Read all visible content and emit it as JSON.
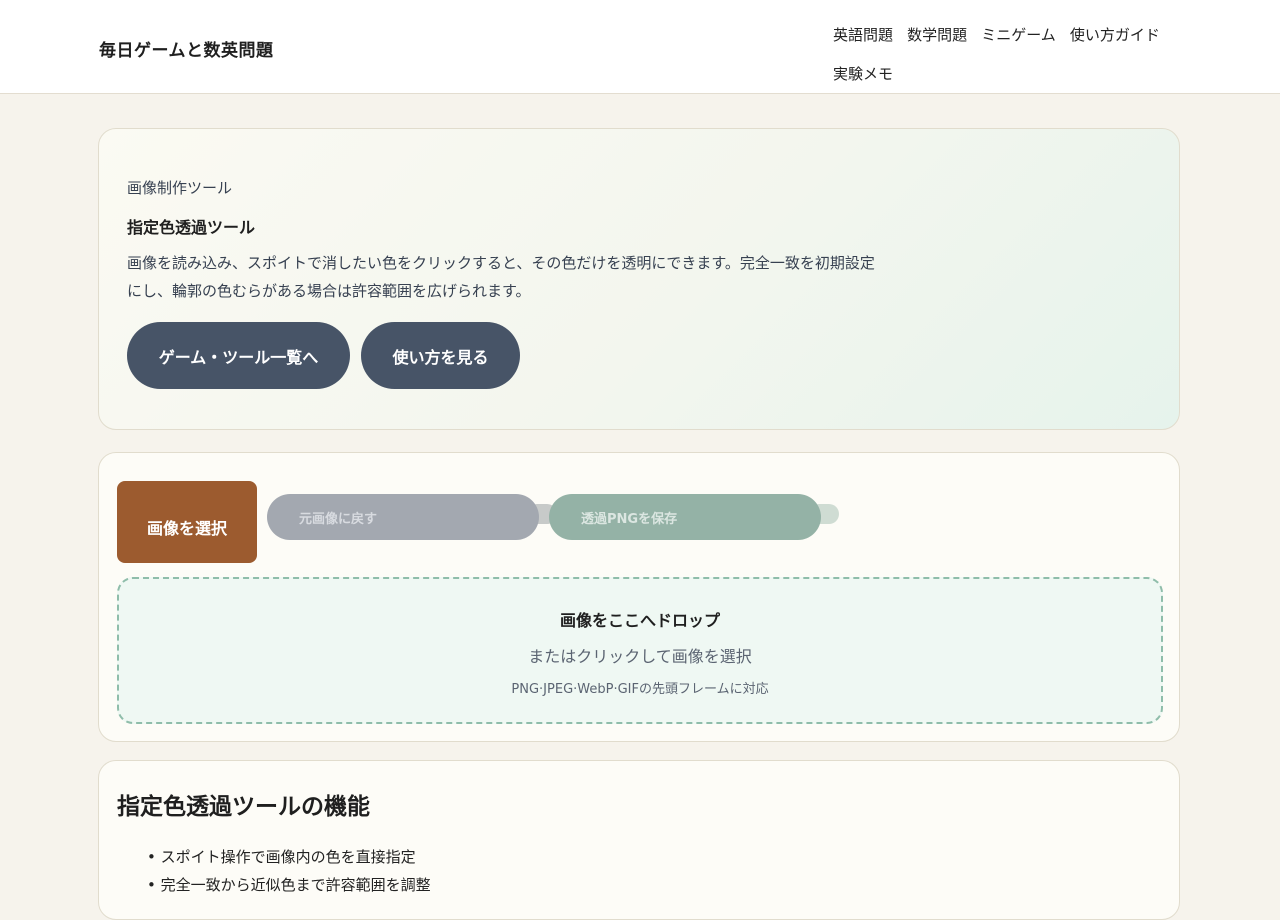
{
  "header": {
    "site_title": "毎日ゲームと数英問題",
    "nav": [
      {
        "label": "英語問題"
      },
      {
        "label": "数学問題"
      },
      {
        "label": "ミニゲーム"
      },
      {
        "label": "使い方ガイド"
      },
      {
        "label": "実験メモ"
      }
    ]
  },
  "hero": {
    "eyebrow": "画像制作ツール",
    "title": "指定色透過ツール",
    "description": "画像を読み込み、スポイトで消したい色をクリックすると、その色だけを透明にできます。完全一致を初期設定にし、輪郭の色むらがある場合は許容範囲を広げられます。",
    "buttons": {
      "games": "ゲーム・ツール一覧へ",
      "howto": "使い方を見る"
    }
  },
  "tool": {
    "select_button": "画像を選択",
    "reset_button": "元画像に戻す",
    "save_button": "透過PNGを保存",
    "dropzone": {
      "title": "画像をここへドロップ",
      "subtitle": "またはクリックして画像を選択",
      "note": "PNG·JPEG·WebP·GIFの先頭フレームに対応"
    }
  },
  "features": {
    "heading": "指定色透過ツールの機能",
    "items": [
      {
        "text": "スポイト操作で画像内の色を直接指定"
      },
      {
        "text": "完全一致から近似色まで許容範囲を調整"
      }
    ]
  },
  "colors": {
    "page_bg": "#f6f3ec",
    "primary_pill": "#475467",
    "select_button": "#9c5b2f",
    "dropzone_border": "#8fbdaa"
  }
}
